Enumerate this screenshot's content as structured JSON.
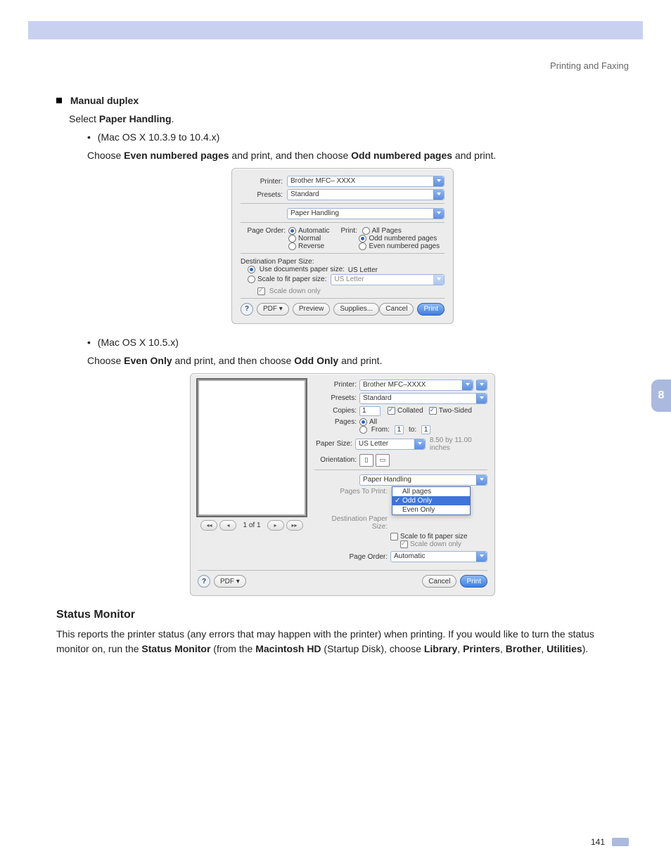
{
  "header": {
    "breadcrumb": "Printing and Faxing"
  },
  "section1": {
    "heading": "Manual duplex",
    "select_line": {
      "pre": "Select ",
      "bold": "Paper Handling",
      "post": "."
    },
    "sub1_label": "(Mac OS X 10.3.9 to 10.4.x)",
    "sub1_text": {
      "pre": "Choose ",
      "b1": "Even numbered pages",
      "mid": " and print, and then choose ",
      "b2": "Odd numbered pages",
      "post": " and print."
    },
    "sub2_label": "(Mac OS X 10.5.x)",
    "sub2_text": {
      "pre": "Choose ",
      "b1": "Even Only",
      "mid": " and print, and then choose ",
      "b2": "Odd Only",
      "post": " and print."
    }
  },
  "dialog1": {
    "printer_label": "Printer:",
    "printer_value": "Brother MFC– XXXX",
    "presets_label": "Presets:",
    "presets_value": "Standard",
    "panel_value": "Paper Handling",
    "page_order_label": "Page Order:",
    "page_order_opts": [
      "Automatic",
      "Normal",
      "Reverse"
    ],
    "print_label": "Print:",
    "print_opts": [
      "All Pages",
      "Odd numbered pages",
      "Even numbered pages"
    ],
    "dest_label": "Destination Paper Size:",
    "dest_opt1": "Use documents paper size:",
    "dest_opt1_val": "US Letter",
    "dest_opt2": "Scale to fit paper size:",
    "dest_opt2_val": "US Letter",
    "scale_down": "Scale down only",
    "buttons": {
      "pdf": "PDF ▾",
      "preview": "Preview",
      "supplies": "Supplies...",
      "cancel": "Cancel",
      "print": "Print"
    }
  },
  "dialog2": {
    "printer_label": "Printer:",
    "printer_value": "Brother MFC–XXXX",
    "presets_label": "Presets:",
    "presets_value": "Standard",
    "copies_label": "Copies:",
    "copies_value": "1",
    "collated": "Collated",
    "two_sided": "Two-Sided",
    "pages_label": "Pages:",
    "pages_all": "All",
    "pages_from": "From:",
    "pages_from_val": "1",
    "pages_to": "to:",
    "pages_to_val": "1",
    "paper_size_label": "Paper Size:",
    "paper_size_value": "US Letter",
    "paper_size_dim": "8.50 by 11.00 inches",
    "orientation_label": "Orientation:",
    "panel_value": "Paper Handling",
    "pages_to_print_label": "Pages To Print:",
    "pages_to_print_opts": [
      "All pages",
      "Odd Only",
      "Even Only"
    ],
    "dest_label": "Destination Paper Size:",
    "scale_fit": "Scale to fit paper size",
    "scale_down": "Scale down only",
    "page_order_label": "Page Order:",
    "page_order_value": "Automatic",
    "pager": "1 of 1",
    "buttons": {
      "pdf": "PDF ▾",
      "cancel": "Cancel",
      "print": "Print"
    }
  },
  "section2": {
    "heading": "Status Monitor",
    "body": {
      "t1": "This reports the printer status (any errors that may happen with the printer) when printing. If you would like to turn the status monitor on, run the ",
      "b1": "Status Monitor",
      "t2": " (from the ",
      "b2": "Macintosh HD",
      "t3": " (Startup Disk), choose ",
      "b3": "Library",
      "t4": ", ",
      "b4": "Printers",
      "t5": ", ",
      "b5": "Brother",
      "t6": ", ",
      "b6": "Utilities",
      "t7": ")."
    }
  },
  "side_tab": "8",
  "footer": {
    "page": "141"
  }
}
